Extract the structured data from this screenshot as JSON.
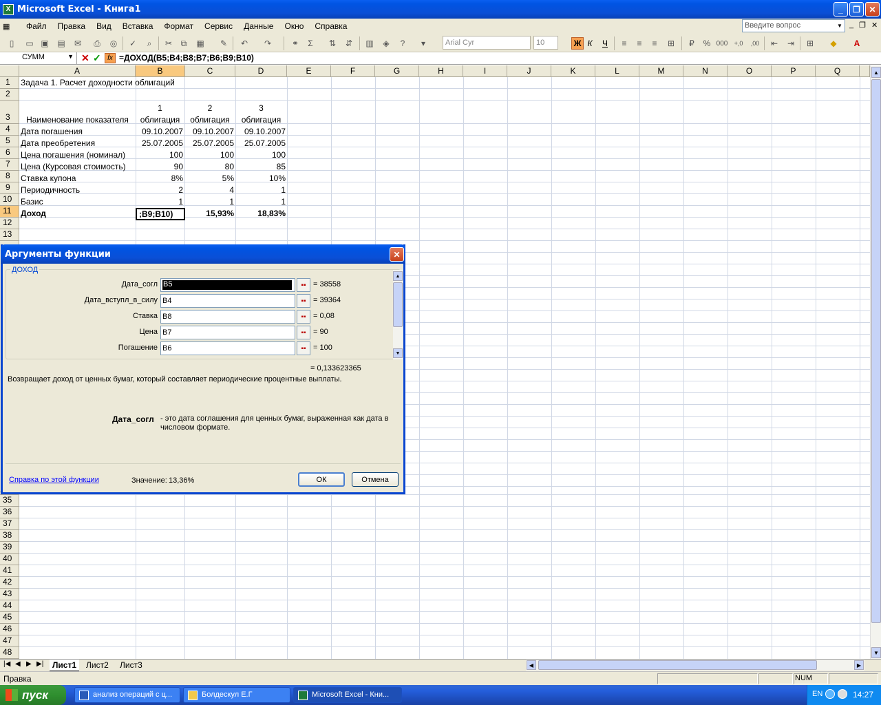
{
  "window": {
    "title": "Microsoft Excel - Книга1"
  },
  "menu": {
    "items": [
      "Файл",
      "Правка",
      "Вид",
      "Вставка",
      "Формат",
      "Сервис",
      "Данные",
      "Окно",
      "Справка"
    ]
  },
  "ask_placeholder": "Введите вопрос",
  "toolbar": {
    "font": "Arial Cyr",
    "size": "10"
  },
  "formula_bar": {
    "name_box": "СУММ",
    "formula": "=ДОХОД(B5;B4;B8;B7;B6;B9;B10)"
  },
  "columns": [
    "A",
    "B",
    "C",
    "D",
    "E",
    "F",
    "G",
    "H",
    "I",
    "J",
    "K",
    "L",
    "M",
    "N",
    "O",
    "P",
    "Q"
  ],
  "rows": [
    "1",
    "2",
    "3",
    "4",
    "5",
    "6",
    "7",
    "8",
    "9",
    "10",
    "11",
    "12",
    "13",
    "35",
    "36",
    "37",
    "38",
    "39",
    "40",
    "41",
    "42",
    "43",
    "44",
    "45",
    "46",
    "47",
    "48"
  ],
  "cells": {
    "a1": "Задача 1. Расчет доходности облигаций",
    "b3a": "1",
    "b3b": "облигация",
    "c3a": "2",
    "c3b": "облигация",
    "d3a": "3",
    "d3b": "облигация",
    "a3": "Наименование показателя",
    "a4": "Дата погашения",
    "b4": "09.10.2007",
    "c4": "09.10.2007",
    "d4": "09.10.2007",
    "a5": "Дата преобретения",
    "b5": "25.07.2005",
    "c5": "25.07.2005",
    "d5": "25.07.2005",
    "a6": "Цена погашения (номинал)",
    "b6": "100",
    "c6": "100",
    "d6": "100",
    "a7": "Цена (Курсовая стоимость)",
    "b7": "90",
    "c7": "80",
    "d7": "85",
    "a8": "Ставка купона",
    "b8": "8%",
    "c8": "5%",
    "d8": "10%",
    "a9": "Периодичность",
    "b9": "2",
    "c9": "4",
    "d9": "1",
    "a10": "Базис",
    "b10": "1",
    "c10": "1",
    "d10": "1",
    "a11": "Доход",
    "b11": ";B9;B10)",
    "c11": "15,93%",
    "d11": "18,83%"
  },
  "sheets": [
    "Лист1",
    "Лист2",
    "Лист3"
  ],
  "status": {
    "text": "Правка",
    "num": "NUM"
  },
  "dialog": {
    "title": "Аргументы функции",
    "function_name": "ДОХОД",
    "args": [
      {
        "label": "Дата_согл",
        "value": "B5",
        "result": "= 38558"
      },
      {
        "label": "Дата_вступл_в_силу",
        "value": "B4",
        "result": "= 39364"
      },
      {
        "label": "Ставка",
        "value": "B8",
        "result": "= 0,08"
      },
      {
        "label": "Цена",
        "value": "B7",
        "result": "= 90"
      },
      {
        "label": "Погашение",
        "value": "B6",
        "result": "= 100"
      }
    ],
    "total": "= 0,133623365",
    "description": "Возвращает доход от ценных бумаг, который составляет периодические процентные выплаты.",
    "arg_name": "Дата_согл",
    "arg_help_1": "- это дата соглашения для ценных бумаг, выраженная как дата в",
    "arg_help_2": "числовом формате.",
    "help_link": "Справка по этой функции",
    "value_label": "Значение:",
    "value": "13,36%",
    "ok": "ОК",
    "cancel": "Отмена"
  },
  "taskbar": {
    "start": "пуск",
    "tasks": [
      "анализ операций с ц...",
      "Болдескул Е.Г",
      "Microsoft Excel - Кни..."
    ],
    "lang": "EN",
    "time": "14:27"
  }
}
